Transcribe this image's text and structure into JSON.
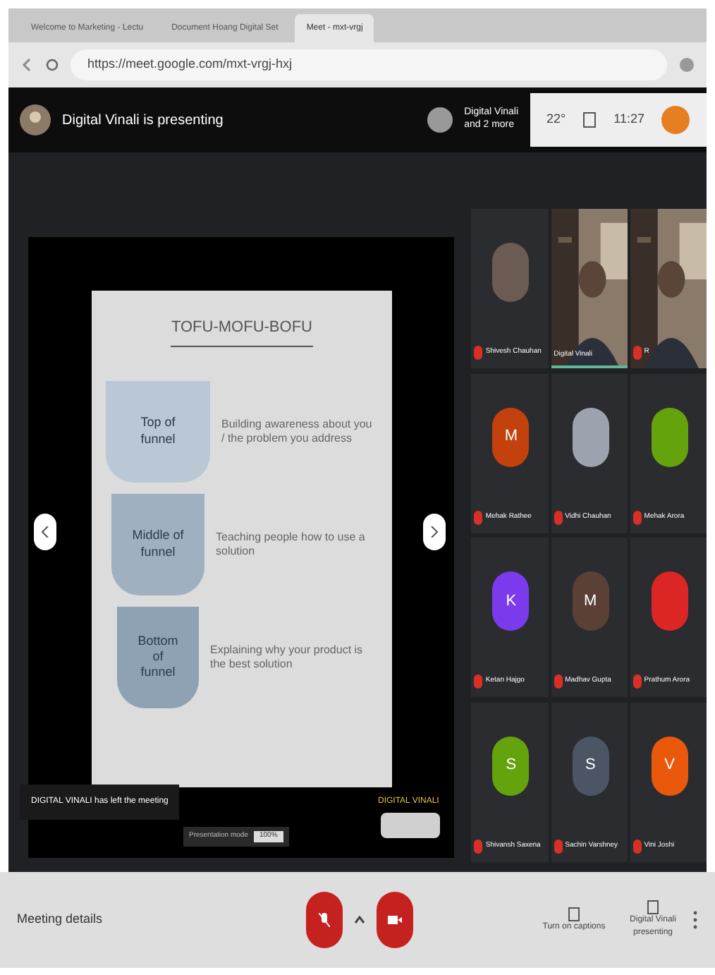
{
  "browser": {
    "tabs": [
      {
        "title": "Welcome to Marketing - Lectu",
        "selected": false
      },
      {
        "title": "Document Hoang Digital Set",
        "selected": false
      },
      {
        "title": "Meet - mxt-vrgj",
        "selected": true
      }
    ],
    "address": "https://meet.google.com/mxt-vrgj-hxj"
  },
  "top_bar": {
    "presenter": "Digital Vinali is presenting",
    "others_line1": "Digital Vinali",
    "others_line2": "and 2 more",
    "temperature": "22°",
    "time": "11:27"
  },
  "slide": {
    "title": "TOFU-MOFU-BOFU",
    "stages": [
      {
        "label": "Top of funnel",
        "text": "Building awareness about you / the problem you address"
      },
      {
        "label": "Middle of funnel",
        "text": "Teaching people how to use a solution"
      },
      {
        "label": "Bottom of funnel",
        "text": "Explaining why your product is the best solution"
      }
    ],
    "notice": "DIGITAL VINALI has left the meeting",
    "presenter_label": "DIGITAL VINALI",
    "toolbar_label": "Presentation mode",
    "zoom": "100%"
  },
  "participants": [
    {
      "kind": "avatar",
      "name": "Shivesh Chauhan",
      "color": "#6b5b52",
      "muted": true,
      "speaking": false
    },
    {
      "kind": "video",
      "name": "Digital Vinali",
      "muted": false,
      "speaking": true
    },
    {
      "kind": "video",
      "name": "R",
      "muted": true,
      "speaking": false
    },
    {
      "kind": "avatar",
      "name": "Mehak Rathee",
      "initial": "M",
      "color": "#c2410c",
      "muted": true,
      "speaking": false
    },
    {
      "kind": "avatar",
      "name": "Vidhi Chauhan",
      "color": "#9ca3af",
      "muted": true,
      "speaking": false
    },
    {
      "kind": "avatar",
      "name": "Mehak Arora",
      "color": "#65a30d",
      "muted": true,
      "speaking": false
    },
    {
      "kind": "avatar",
      "name": "Ketan Hajgo",
      "initial": "K",
      "color": "#7c3aed",
      "muted": true,
      "speaking": false
    },
    {
      "kind": "avatar",
      "name": "Madhav Gupta",
      "initial": "M",
      "color": "#5b4036",
      "muted": true,
      "speaking": false
    },
    {
      "kind": "avatar",
      "name": "Prathum Arora",
      "color": "#dc2626",
      "muted": true,
      "speaking": false
    },
    {
      "kind": "avatar",
      "name": "Shivansh Saxena",
      "initial": "S",
      "color": "#65a30d",
      "muted": true,
      "speaking": false
    },
    {
      "kind": "avatar",
      "name": "Sachin Varshney",
      "initial": "S",
      "color": "#4b5563",
      "muted": true,
      "speaking": false
    },
    {
      "kind": "avatar",
      "name": "Vini Joshi",
      "initial": "V",
      "color": "#ea580c",
      "muted": true,
      "speaking": false
    }
  ],
  "bottom_bar": {
    "meeting_details": "Meeting details",
    "mic_on": false,
    "camera_on": false,
    "captions": "Turn on captions",
    "presenting_line1": "Digital Vinali",
    "presenting_line2": "presenting"
  }
}
